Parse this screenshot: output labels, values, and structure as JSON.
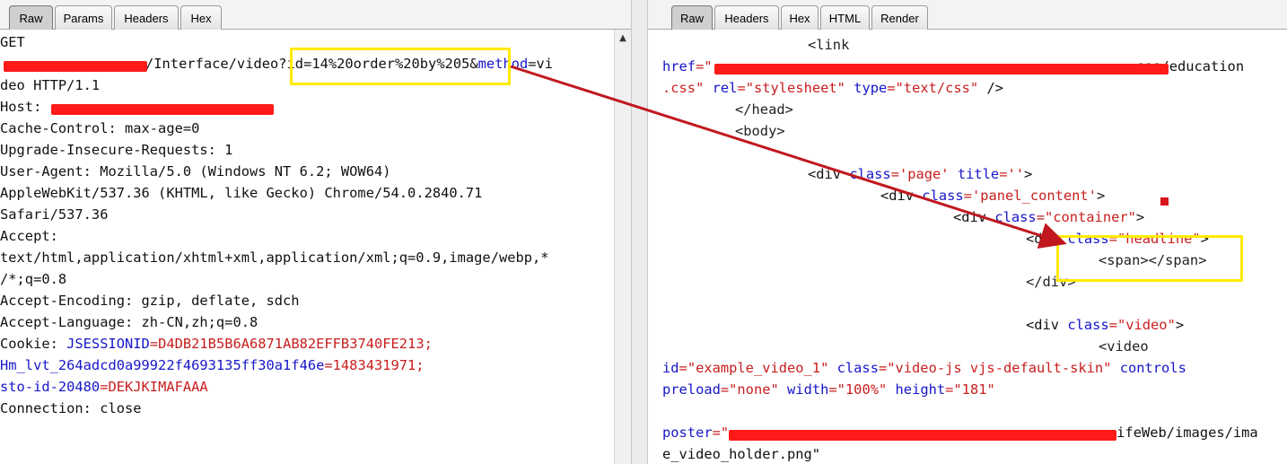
{
  "request": {
    "tabs": [
      "Raw",
      "Params",
      "Headers",
      "Hex"
    ],
    "active_tab": "Raw",
    "lines": {
      "method": "GET",
      "path_segment": "/Interface/video",
      "query_highlight": "?id=14%20order%20by%205&",
      "query_method_key": "method",
      "query_method_val": "=vi",
      "line2": "deo HTTP/1.1",
      "host_label": "Host:",
      "cache_control": "Cache-Control: max-age=0",
      "upgrade": "Upgrade-Insecure-Requests: 1",
      "ua1": "User-Agent: Mozilla/5.0 (Windows NT 6.2; WOW64)",
      "ua2": "AppleWebKit/537.36 (KHTML, like Gecko) Chrome/54.0.2840.71",
      "ua3": "Safari/537.36",
      "accept": "Accept:",
      "accept2": "text/html,application/xhtml+xml,application/xml;q=0.9,image/webp,*",
      "accept3": "/*;q=0.8",
      "accept_enc": "Accept-Encoding: gzip, deflate, sdch",
      "accept_lang": "Accept-Language: zh-CN,zh;q=0.8",
      "cookie_label": "Cookie: ",
      "cookie1_key": "JSESSIONID",
      "cookie1_val": "=D4DB21B5B6A6871AB82EFFB3740FE213;",
      "cookie2_key": "Hm_lvt_264adcd0a99922f4693135ff30a1f46e",
      "cookie2_val": "=1483431971;",
      "cookie3_key": "sto-id-20480",
      "cookie3_val": "=DEKJKIMAFAAA",
      "connection": "Connection: close"
    }
  },
  "response": {
    "tabs": [
      "Raw",
      "Headers",
      "Hex",
      "HTML",
      "Render"
    ],
    "active_tab": "Raw",
    "lines": {
      "link_open": "<link",
      "href_key": "href",
      "href_eq": "=\"",
      "href_tail": "css/education",
      "css_tail": ".css\"",
      "rel_key": "rel",
      "rel_val": "=\"stylesheet\"",
      "type_key": "type",
      "type_val": "=\"text/css\"",
      "self_close": " />",
      "head_close": "</head>",
      "body_open": "<body>",
      "div_page_open": "<div ",
      "class_key": "class",
      "page_val": "='page'",
      "title_key": "title",
      "title_val": "=''",
      "gt": ">",
      "panel_val": "='panel_content'",
      "container_val": "=\"container\"",
      "headline_val": "=\"headline\"",
      "span_pair": "<span></span>",
      "div_close": "</div>",
      "video_class_val": "=\"video\"",
      "video_open": "<video",
      "id_key": "id",
      "id_val": "=\"example_video_1\"",
      "video_class2": "=\"video-js vjs-default-skin\"",
      "controls": "controls",
      "preload_key": "preload",
      "preload_val": "=\"none\"",
      "width_key": "width",
      "width_val": "=\"100%\"",
      "height_key": "height",
      "height_val": "=\"181\"",
      "poster_key": "poster",
      "poster_tail": "ifeWeb/images/ima",
      "poster_line2": "e_video_holder.png\""
    }
  },
  "colors": {
    "highlight_box": "#ffea00",
    "redaction": "#ff1a1a",
    "annotation_arrow": "#c0181e"
  }
}
